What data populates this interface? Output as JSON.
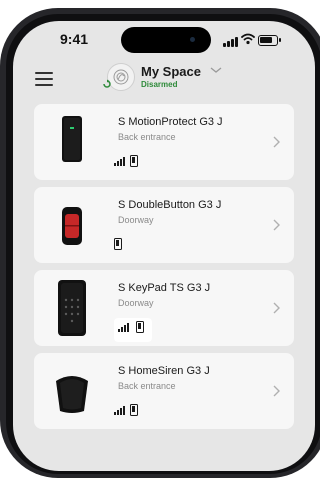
{
  "status_bar": {
    "time": "9:41"
  },
  "header": {
    "space_name": "My Space",
    "space_status": "Disarmed",
    "status_color": "#2e8b3a"
  },
  "devices": [
    {
      "name": "S MotionProtect G3 J",
      "room": "Back entrance",
      "icon": "motion-sensor-device",
      "has_signal": true
    },
    {
      "name": "S DoubleButton G3 J",
      "room": "Doorway",
      "icon": "double-button-device",
      "has_signal": false
    },
    {
      "name": "S KeyPad TS G3 J",
      "room": "Doorway",
      "icon": "keypad-device",
      "has_signal": true,
      "status_highlighted": true
    },
    {
      "name": "S HomeSiren G3 J",
      "room": "Back entrance",
      "icon": "siren-device",
      "has_signal": true
    }
  ]
}
